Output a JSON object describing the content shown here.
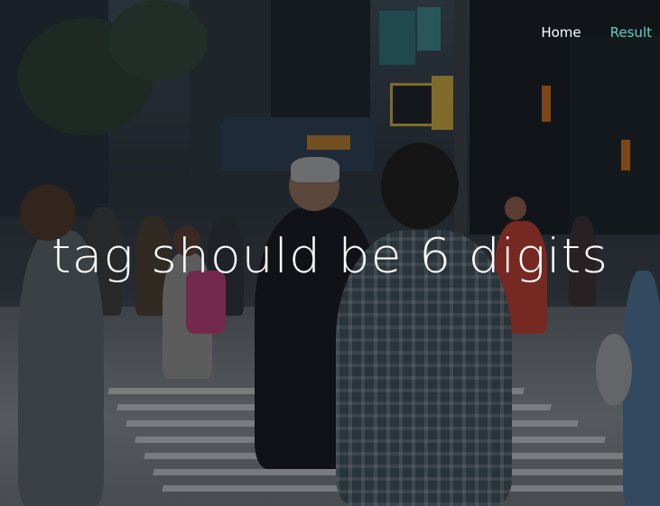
{
  "nav": {
    "home_label": "Home",
    "result_label": "Result",
    "home_color": "#ffffff",
    "active_color": "#5fd3c3"
  },
  "hero": {
    "message": "tag should be 6 digits"
  }
}
